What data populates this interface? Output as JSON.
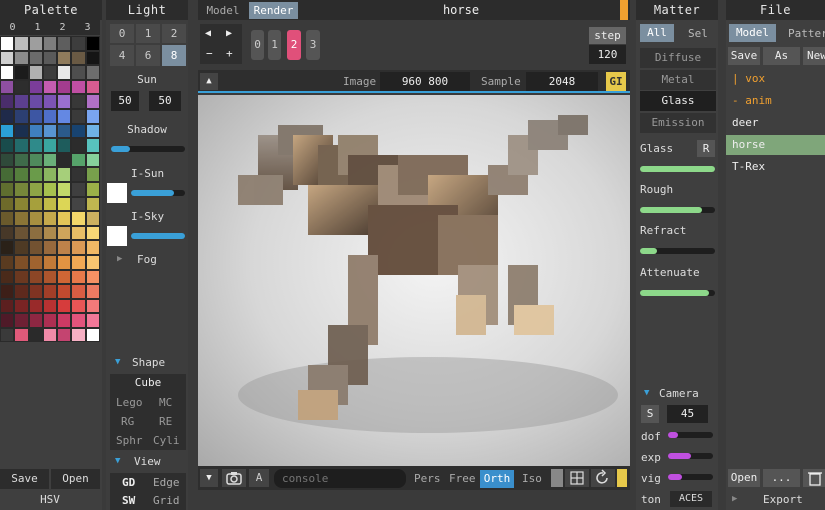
{
  "palette": {
    "title": "Palette",
    "tabs": [
      "0",
      "1",
      "2",
      "3"
    ],
    "footer": {
      "save": "Save",
      "open": "Open",
      "mode": "HSV"
    },
    "colors": [
      "#ffffff",
      "#bdbdbd",
      "#9e9e9e",
      "#7d7d7d",
      "#5e5e5e",
      "#3d3d3d",
      "#000000",
      "#cfcfcf",
      "#8c8c8c",
      "#6b6b6b",
      "#5a5a5a",
      "#8f7b5c",
      "#6a5a44",
      "#151515",
      "#ffffff",
      "#1c1c1c",
      "#b0b0b0",
      "#3c3c3c",
      "#e8e8e8",
      "#4e4e4e",
      "#6d6d6d",
      "#8e4fa1",
      "#2d2d2d",
      "#7b3d9a",
      "#c45cb0",
      "#a33c8f",
      "#bf4fa3",
      "#d65c91",
      "#4a2d6b",
      "#5c3f8f",
      "#6a4ba6",
      "#7c54b5",
      "#9a6fcf",
      "#383838",
      "#b070c6",
      "#1f2a4a",
      "#2c3f72",
      "#3d56a3",
      "#4f6fc9",
      "#6488e3",
      "#3a3a3a",
      "#7aa5f0",
      "#2ba0d7",
      "#1a2f4f",
      "#3f7fbf",
      "#5894d1",
      "#2b5a8a",
      "#184370",
      "#6fb2e6",
      "#194c4c",
      "#236b6b",
      "#2f8a8a",
      "#3aa6a0",
      "#1e5c5c",
      "#2c2c2c",
      "#58c2bd",
      "#2f4a3a",
      "#3f6b4a",
      "#4f8a5c",
      "#6ab079",
      "#2a2a2a",
      "#56a36a",
      "#86d09a",
      "#466b36",
      "#557f3d",
      "#6a9b4a",
      "#8bb660",
      "#a6cf7a",
      "#333333",
      "#78a04c",
      "#5f6e2f",
      "#76873a",
      "#8ea546",
      "#a7c14f",
      "#c2d86a",
      "#3f3f3f",
      "#9bb048",
      "#6e6a2a",
      "#8a8533",
      "#a6a03c",
      "#c2bc48",
      "#dcd656",
      "#444444",
      "#bfb650",
      "#6a5a2c",
      "#8a7536",
      "#a78f40",
      "#c5a94c",
      "#e3c558",
      "#f2d66a",
      "#ccb060",
      "#473828",
      "#6a5334",
      "#8c6e40",
      "#ad8a4d",
      "#cfa55b",
      "#e8be66",
      "#f6d676",
      "#2a2118",
      "#4e3a24",
      "#735231",
      "#98693d",
      "#be824a",
      "#dc9a55",
      "#f0b865",
      "#5a3b20",
      "#7e4f27",
      "#a0632f",
      "#c27a38",
      "#e29342",
      "#f1a854",
      "#f7c470",
      "#4a2a1a",
      "#6b3820",
      "#8c4626",
      "#ad552d",
      "#cf6635",
      "#e8794a",
      "#f59164",
      "#3d1f18",
      "#5e291d",
      "#7f3322",
      "#a13e28",
      "#c24a2f",
      "#d95d43",
      "#ec7a62",
      "#5c1f1f",
      "#7a2424",
      "#992a2a",
      "#b83232",
      "#d63c3c",
      "#e85656",
      "#f47a7a",
      "#4f1a28",
      "#6e2034",
      "#8d2742",
      "#ad2f52",
      "#cc3a64",
      "#e2547c",
      "#f27898",
      "#3a3a3a",
      "#e05a7a",
      "#2a2a2a",
      "#f08aa8",
      "#c44470",
      "#f6b0c4",
      "#ffffff"
    ]
  },
  "light": {
    "title": "Light",
    "buttons_row1": [
      "0",
      "1",
      "2"
    ],
    "buttons_row2": [
      "4",
      "6",
      "8"
    ],
    "selected_row2_index": 2,
    "sun_label": "Sun",
    "sun_values": [
      "50",
      "50"
    ],
    "shadow_label": "Shadow",
    "shadow_level": 0.25,
    "isun_label": "I-Sun",
    "isun_level": 0.8,
    "isky_label": "I-Sky",
    "isky_level": 1.0,
    "fog_label": "Fog",
    "shape_label": "Shape",
    "shape_selected": "Cube",
    "shape_options": [
      [
        "Lego",
        "MC"
      ],
      [
        "RG",
        "RE"
      ],
      [
        "Sphr",
        "Cyli"
      ]
    ],
    "view_label": "View",
    "view_options": [
      [
        "GD",
        "Edge"
      ],
      [
        "SW",
        "Grid"
      ]
    ]
  },
  "main": {
    "tabs": [
      "Model",
      "Render"
    ],
    "selected_tab": "Render",
    "file_name": "horse",
    "frame_buttons": [
      "0",
      "1",
      "2",
      "3"
    ],
    "selected_frame": "2",
    "nav_arrows": [
      "◀",
      "▶",
      "−",
      "+"
    ],
    "step_label": "step",
    "step_value": "120",
    "image_label": "Image",
    "image_value": "960 800",
    "sample_label": "Sample",
    "sample_value": "2048",
    "gi_label": "GI",
    "console_placeholder": "console",
    "camera_modes": [
      "Pers",
      "Free",
      "Orth",
      "Iso"
    ],
    "selected_camera_mode": "Orth",
    "bottom_a_label": "A"
  },
  "matter": {
    "title": "Matter",
    "tabs": [
      "All",
      "Sel"
    ],
    "selected_tab": "All",
    "options": [
      "Diffuse",
      "Metal",
      "Glass",
      "Emission"
    ],
    "selected_option": "Glass",
    "sliders": [
      {
        "label": "Glass",
        "level": 1.0,
        "extra": "R"
      },
      {
        "label": "Rough",
        "level": 0.82
      },
      {
        "label": "Refract",
        "level": 0.22
      },
      {
        "label": "Attenuate",
        "level": 0.92
      }
    ],
    "camera_label": "Camera",
    "camera_s": "S",
    "camera_value": "45",
    "dof_label": "dof",
    "dof_level": 0.2,
    "exp_label": "exp",
    "exp_level": 0.5,
    "vig_label": "vig",
    "vig_level": 0.3,
    "ton_label": "ton",
    "ton_value": "ACES"
  },
  "file": {
    "title": "File",
    "tabs": [
      "Model",
      "Patter"
    ],
    "selected_tab": "Model",
    "actions": [
      "Save",
      "As",
      "New"
    ],
    "items": [
      {
        "label": "| vox",
        "color": "#f0a030"
      },
      {
        "label": "- anim",
        "color": "#f0a030"
      },
      {
        "label": "deer",
        "color": "#eeeeee"
      },
      {
        "label": "horse",
        "color": "#eeeeee",
        "selected": true
      },
      {
        "label": "T-Rex",
        "color": "#eeeeee"
      }
    ],
    "footer_open": "Open",
    "footer_more": "...",
    "export_label": "Export"
  },
  "colors": {
    "accent": "#3aa0d8",
    "selected": "#7b8fa0",
    "pink": "#e0507a",
    "green": "#8dd88a",
    "magenta": "#c050e0",
    "orange": "#f0a030",
    "gi_yellow": "#e6c84a"
  }
}
